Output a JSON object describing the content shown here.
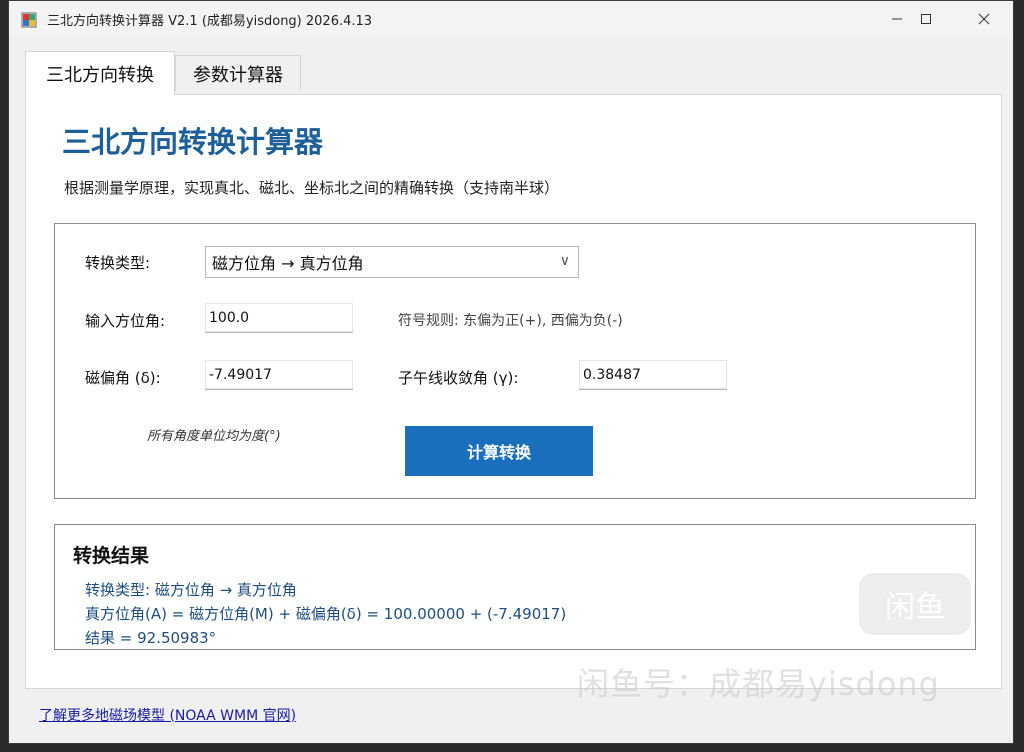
{
  "window": {
    "title": "三北方向转换计算器 V2.1 (成都易yisdong) 2026.4.13",
    "minimize_icon": "minimize-icon",
    "maximize_icon": "maximize-icon",
    "close_icon": "close-icon"
  },
  "tabs": [
    {
      "label": "三北方向转换",
      "active": true
    },
    {
      "label": "参数计算器",
      "active": false
    }
  ],
  "main": {
    "heading": "三北方向转换计算器",
    "subtitle": "根据测量学原理，实现真北、磁北、坐标北之间的精确转换（支持南半球）"
  },
  "form": {
    "conversion_type_label": "转换类型:",
    "conversion_type_value": "磁方位角 → 真方位角",
    "input_azimuth_label": "输入方位角:",
    "input_azimuth_value": "100.0",
    "sign_rule": "符号规则: 东偏为正(+), 西偏为负(-)",
    "declination_label": "磁偏角 (δ):",
    "declination_value": "-7.49017",
    "convergence_label": "子午线收敛角 (γ):",
    "convergence_value": "0.38487",
    "units_note": "所有角度单位均为度(°)",
    "calculate_button": "计算转换"
  },
  "result": {
    "title": "转换结果",
    "lines": [
      "转换类型: 磁方位角 → 真方位角",
      "真方位角(A) = 磁方位角(M) + 磁偏角(δ) = 100.00000 + (-7.49017)",
      "结果 = 92.50983°"
    ]
  },
  "footer": {
    "link": "了解更多地磁场模型 (NOAA WMM 官网)"
  },
  "watermark": {
    "text": "闲鱼号：成都易yisdong",
    "logo": "闲鱼"
  },
  "colors": {
    "heading": "#1f5f99",
    "button": "#1a6fbd",
    "result_text": "#1f4d80",
    "link": "#1a1aa6"
  }
}
